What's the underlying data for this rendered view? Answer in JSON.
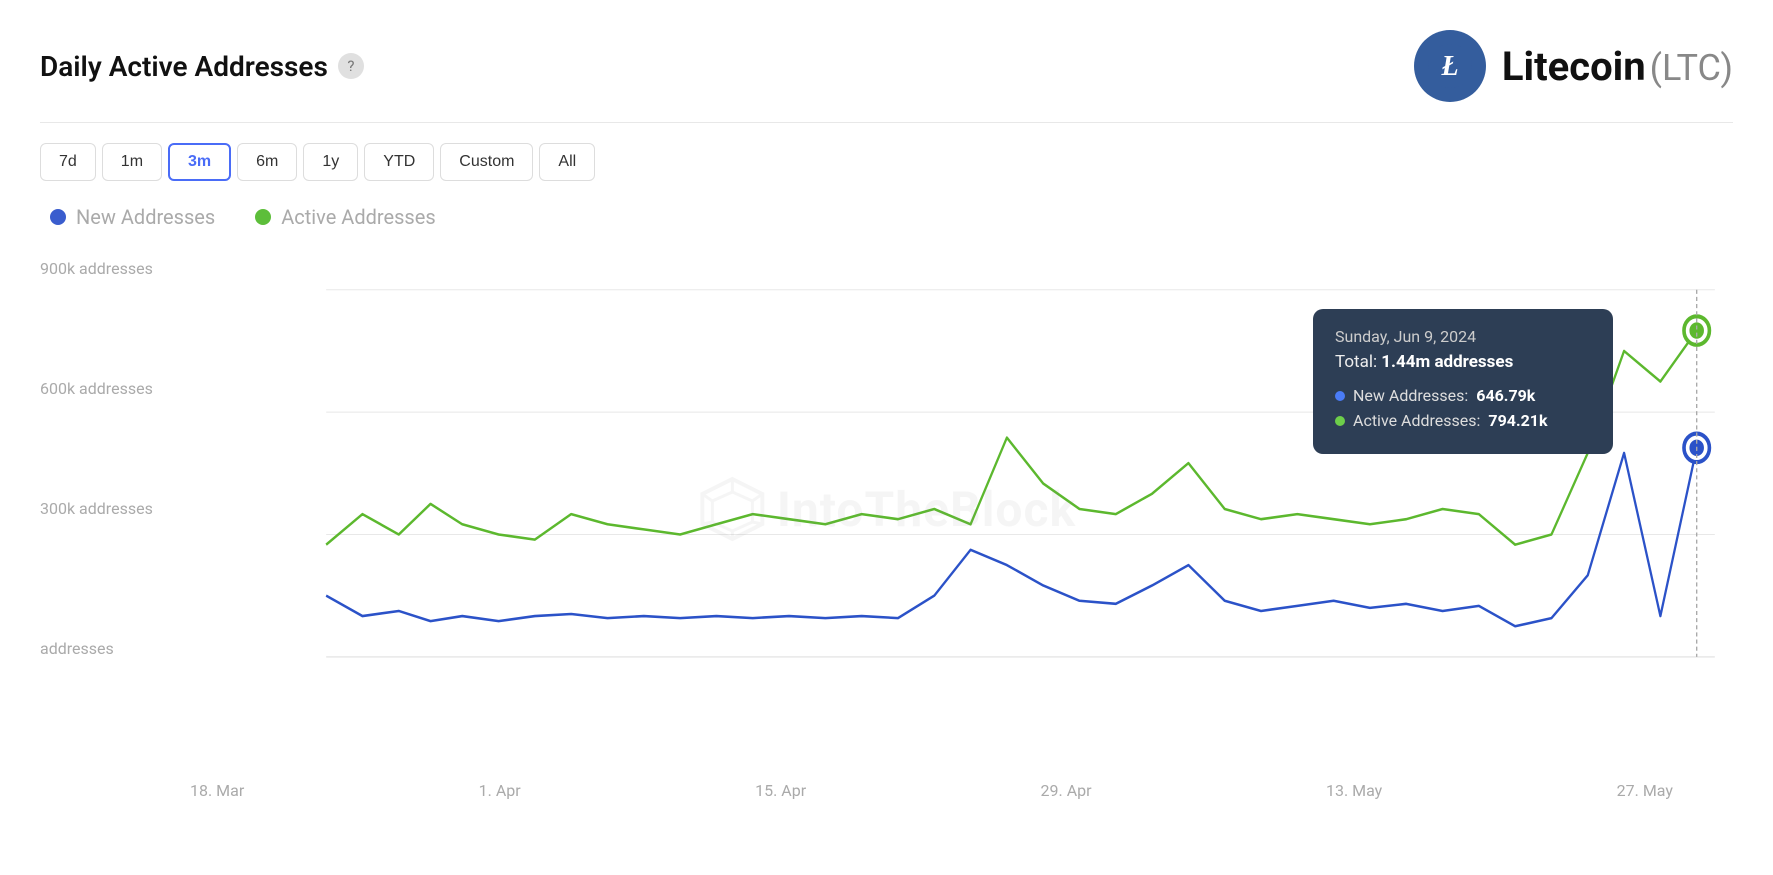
{
  "header": {
    "title": "Daily Active Addresses",
    "help_icon": "?",
    "brand_name": "Litecoin",
    "brand_ticker": "(LTC)"
  },
  "time_filters": {
    "buttons": [
      "7d",
      "1m",
      "3m",
      "6m",
      "1y",
      "YTD",
      "Custom",
      "All"
    ],
    "active": "3m"
  },
  "legend": {
    "items": [
      {
        "label": "New Addresses",
        "color": "#3a5dce"
      },
      {
        "label": "Active Addresses",
        "color": "#5dbe3a"
      }
    ]
  },
  "y_axis": {
    "labels": [
      "900k addresses",
      "600k addresses",
      "300k addresses",
      "addresses"
    ]
  },
  "x_axis": {
    "labels": [
      "18. Mar",
      "1. Apr",
      "15. Apr",
      "29. Apr",
      "13. May",
      "27. May"
    ]
  },
  "tooltip": {
    "date": "Sunday, Jun 9, 2024",
    "total_label": "Total:",
    "total_value": "1.44m addresses",
    "items": [
      {
        "label": "New Addresses:",
        "value": "646.79k",
        "color": "#4a7cf7"
      },
      {
        "label": "Active Addresses:",
        "value": "794.21k",
        "color": "#6dce4a"
      }
    ]
  },
  "watermark": {
    "text": "IntoTheBlock"
  },
  "colors": {
    "blue_line": "#2b52c8",
    "green_line": "#5cb82e",
    "tooltip_bg": "#2d3e55",
    "accent": "#4a6cf7"
  }
}
